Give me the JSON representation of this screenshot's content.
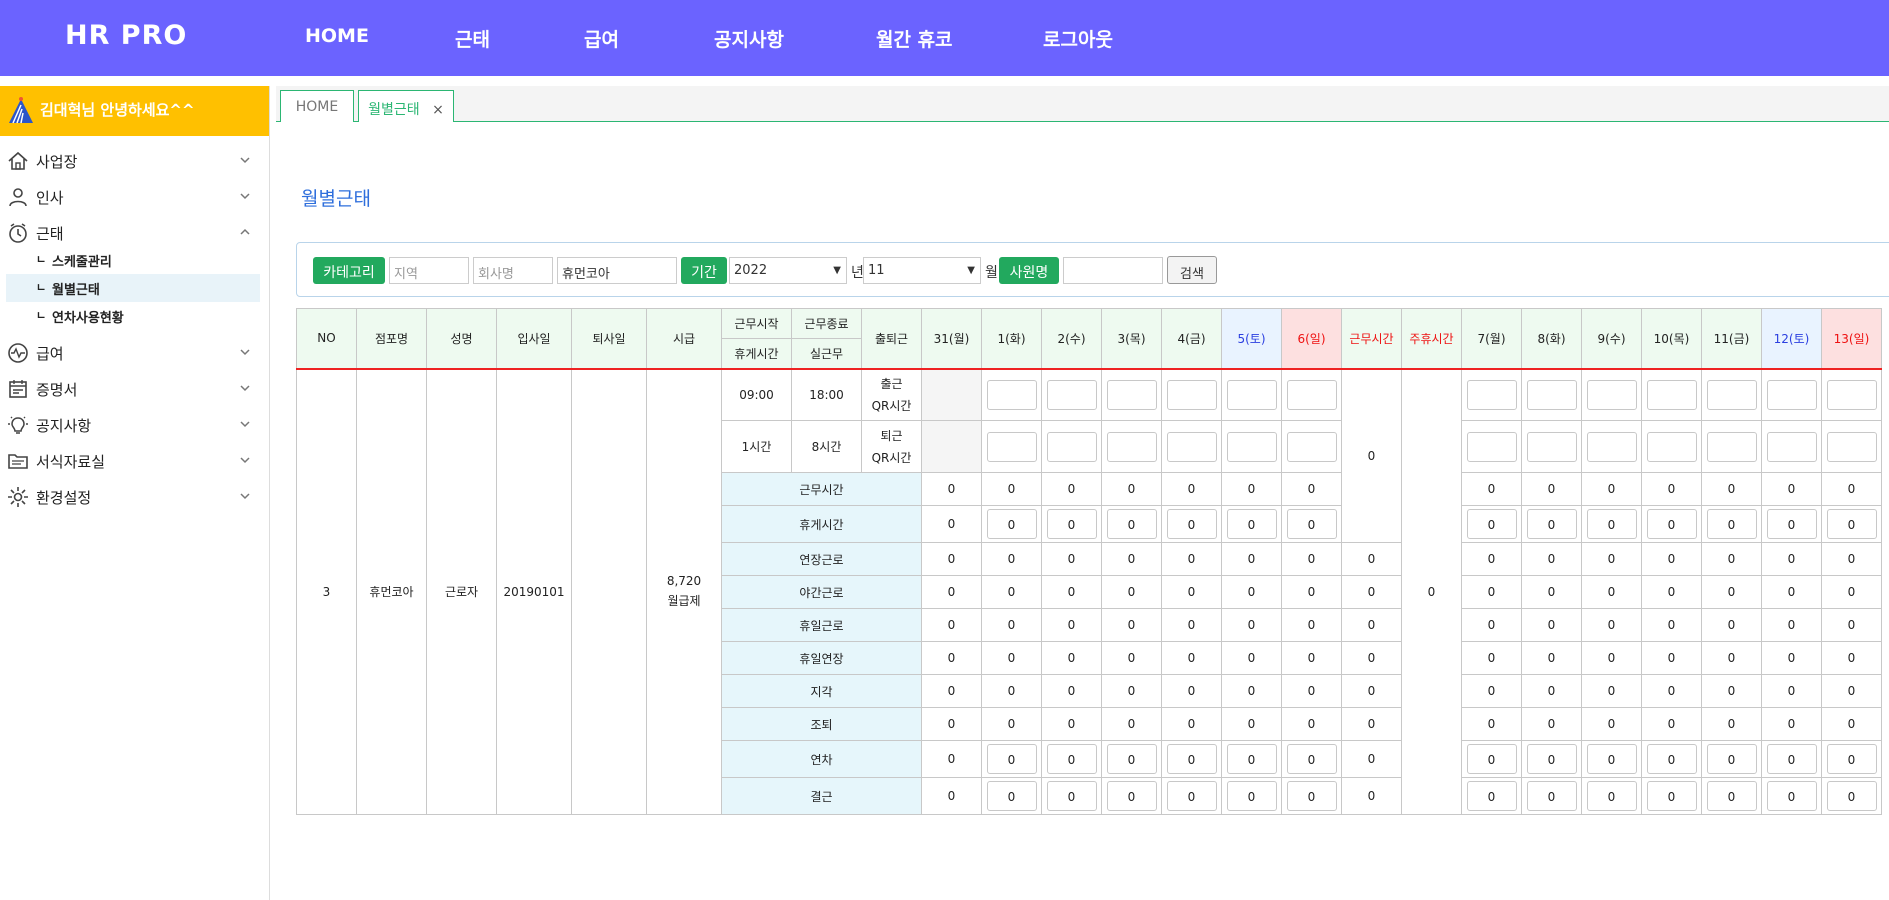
{
  "header": {
    "brand": "HR PRO",
    "nav": [
      "HOME",
      "근태",
      "급여",
      "공지사항",
      "월간 휴코",
      "로그아웃"
    ]
  },
  "sidebar": {
    "welcome": "김대혁님 안녕하세요^^",
    "menu": [
      {
        "label": "사업장",
        "icon": "home-icon",
        "expanded": false
      },
      {
        "label": "인사",
        "icon": "user-icon",
        "expanded": false
      },
      {
        "label": "근태",
        "icon": "clock-icon",
        "expanded": true
      },
      {
        "label": "급여",
        "icon": "wave-icon",
        "expanded": false
      },
      {
        "label": "증명서",
        "icon": "calendar-icon",
        "expanded": false
      },
      {
        "label": "공지사항",
        "icon": "bulb-icon",
        "expanded": false
      },
      {
        "label": "서식자료실",
        "icon": "folder-icon",
        "expanded": false
      },
      {
        "label": "환경설정",
        "icon": "gear-icon",
        "expanded": false
      }
    ],
    "submenu": [
      "스케줄관리",
      "월별근태",
      "연차사용현황"
    ],
    "active_submenu": "월별근태"
  },
  "tabs": [
    {
      "label": "HOME",
      "active": false
    },
    {
      "label": "월별근태",
      "active": true,
      "close": "×"
    }
  ],
  "page_title": "월별근태",
  "filter": {
    "category_btn": "카테고리",
    "region_placeholder": "지역",
    "company_placeholder": "회사명",
    "store_value": "휴먼코아",
    "period_btn": "기간",
    "year_value": "2022",
    "year_unit": "년",
    "month_value": "11",
    "month_unit": "월",
    "employee_btn": "사원명",
    "search_btn": "검색"
  },
  "table": {
    "headers": {
      "no": "NO",
      "store": "점포명",
      "name": "성명",
      "join": "입사일",
      "leave": "퇴사일",
      "wage": "시급",
      "work_start": "근무시작",
      "work_end": "근무종료",
      "break_time": "휴게시간",
      "actual_work": "실근무",
      "inout": "출퇴근",
      "work_hours": "근무시간",
      "weekly_rest": "주휴시간"
    },
    "days_week1": [
      {
        "label": "31(월)",
        "type": "normal"
      },
      {
        "label": "1(화)",
        "type": "normal"
      },
      {
        "label": "2(수)",
        "type": "normal"
      },
      {
        "label": "3(목)",
        "type": "normal"
      },
      {
        "label": "4(금)",
        "type": "normal"
      },
      {
        "label": "5(토)",
        "type": "sat"
      },
      {
        "label": "6(일)",
        "type": "sun"
      }
    ],
    "days_week2": [
      {
        "label": "7(월)",
        "type": "normal"
      },
      {
        "label": "8(화)",
        "type": "normal"
      },
      {
        "label": "9(수)",
        "type": "normal"
      },
      {
        "label": "10(목)",
        "type": "normal"
      },
      {
        "label": "11(금)",
        "type": "normal"
      },
      {
        "label": "12(토)",
        "type": "sat"
      },
      {
        "label": "13(일)",
        "type": "sun"
      }
    ],
    "record": {
      "no": "3",
      "store": "휴먼코아",
      "name": "근로자",
      "join": "20190101",
      "leave": "",
      "wage": "8,720",
      "wage_type": "월급제",
      "start_time": "09:00",
      "end_time": "18:00",
      "break": "1시간",
      "actual": "8시간",
      "in_label": "출근",
      "in_qr": "QR시간",
      "out_label": "퇴근",
      "out_qr": "QR시간",
      "work_hours_total": "0",
      "weekly_rest_total": "0"
    },
    "categories": [
      {
        "label": "근무시간",
        "inputs": false,
        "total": ""
      },
      {
        "label": "휴게시간",
        "inputs": true,
        "total": ""
      },
      {
        "label": "연장근로",
        "inputs": false,
        "total": "0"
      },
      {
        "label": "야간근로",
        "inputs": false,
        "total": "0"
      },
      {
        "label": "휴일근로",
        "inputs": false,
        "total": "0"
      },
      {
        "label": "휴일연장",
        "inputs": false,
        "total": "0"
      },
      {
        "label": "지각",
        "inputs": false,
        "total": "0"
      },
      {
        "label": "조퇴",
        "inputs": false,
        "total": "0"
      },
      {
        "label": "연차",
        "inputs": true,
        "total": "0"
      },
      {
        "label": "결근",
        "inputs": true,
        "total": "0"
      }
    ],
    "zero": "0"
  }
}
